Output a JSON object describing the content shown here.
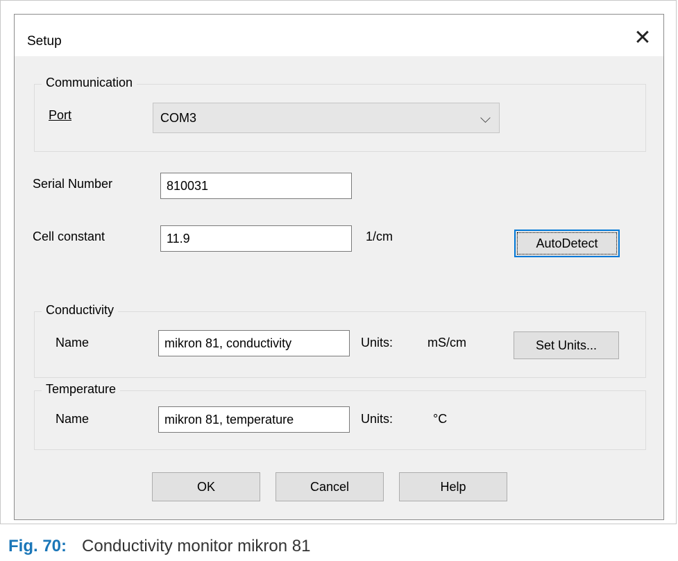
{
  "dialog": {
    "title": "Setup",
    "close_glyph": "✕"
  },
  "communication": {
    "legend": "Communication",
    "port_label": "Port",
    "port_value": "COM3",
    "chevron_glyph": "⌵"
  },
  "serial_number": {
    "label": "Serial Number",
    "value": "810031"
  },
  "cell_constant": {
    "label": "Cell constant",
    "value": "11.9",
    "unit": "1/cm",
    "autodetect_label": "AutoDetect"
  },
  "conductivity": {
    "legend": "Conductivity",
    "name_label": "Name",
    "name_value": "mikron 81, conductivity",
    "units_label": "Units:",
    "units_value": "mS/cm",
    "set_units_label": "Set Units..."
  },
  "temperature": {
    "legend": "Temperature",
    "name_label": "Name",
    "name_value": "mikron 81, temperature",
    "units_label": "Units:",
    "units_value": "°C"
  },
  "buttons": {
    "ok": "OK",
    "cancel": "Cancel",
    "help": "Help"
  },
  "caption": {
    "fig_number": "Fig. 70:",
    "text": "Conductivity monitor mikron 81"
  },
  "colors": {
    "accent": "#0078d7",
    "caption_fig": "#1a76b8",
    "dialog_bg": "#f0f0f0"
  }
}
